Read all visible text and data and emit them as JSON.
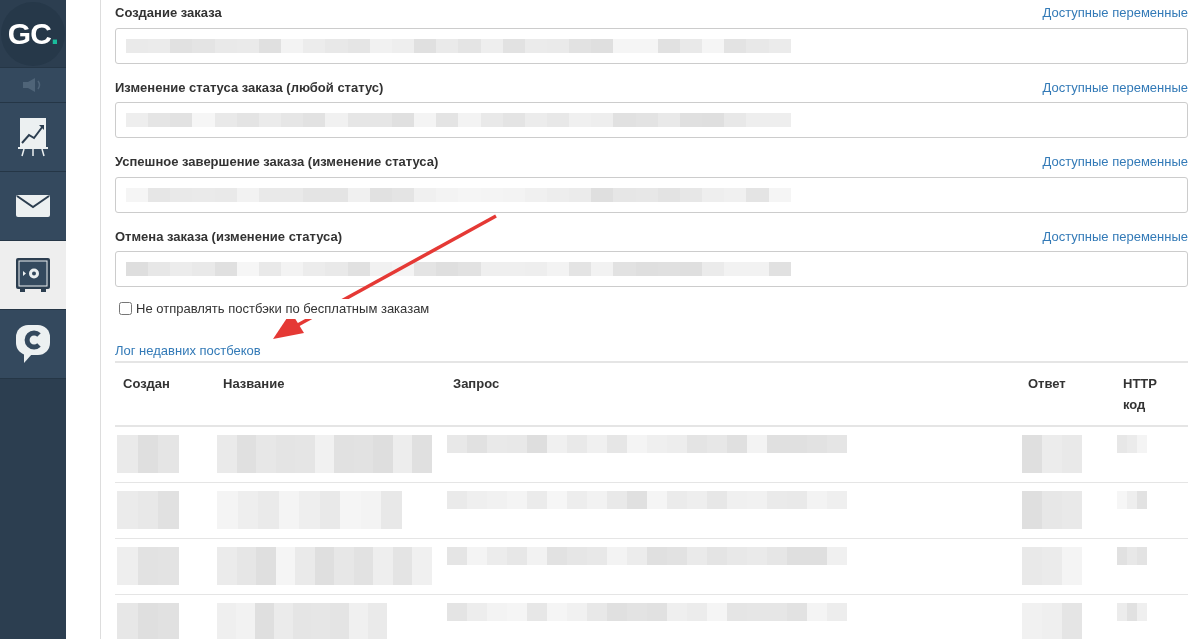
{
  "sidebar": {
    "logo": {
      "text": "GC",
      "accent": "."
    },
    "items": [
      {
        "kind": "speaker",
        "selected": false
      },
      {
        "kind": "chart",
        "selected": false
      },
      {
        "kind": "mail",
        "selected": false
      },
      {
        "kind": "safe",
        "selected": true
      },
      {
        "kind": "chat",
        "selected": false
      }
    ]
  },
  "fields": [
    {
      "label": "Создание заказа",
      "link": "Доступные переменные",
      "redacted": true
    },
    {
      "label": "Изменение статуса заказа (любой статус)",
      "link": "Доступные переменные",
      "redacted": true
    },
    {
      "label": "Успешное завершение заказа (изменение статуса)",
      "link": "Доступные переменные",
      "redacted": true
    },
    {
      "label": "Отмена заказа (изменение статуса)",
      "link": "Доступные переменные",
      "redacted": true
    }
  ],
  "checkbox": {
    "label": "Не отправлять постбэки по бесплатным заказам",
    "checked": false
  },
  "log_link": "Лог недавних постбеков",
  "table": {
    "columns": [
      "Создан",
      "Название",
      "Запрос",
      "Ответ",
      "HTTP код"
    ],
    "rows": [
      {
        "redacted": true
      },
      {
        "redacted": true
      },
      {
        "redacted": true
      },
      {
        "redacted": true
      }
    ]
  },
  "annotation": {
    "kind": "arrow"
  }
}
